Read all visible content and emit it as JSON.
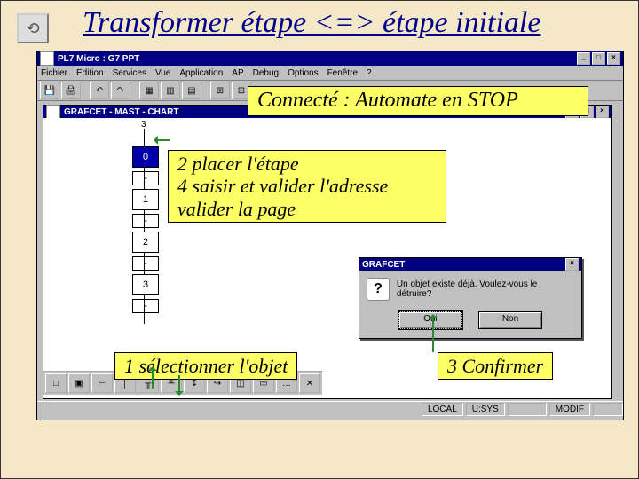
{
  "slide": {
    "title": "Transformer étape <=> étape initiale"
  },
  "app": {
    "title": "PL7 Micro : G7 PPT",
    "menus": [
      "Fichier",
      "Edition",
      "Services",
      "Vue",
      "Application",
      "AP",
      "Debug",
      "Options",
      "Fenêtre",
      "?"
    ],
    "mdi_title": "GRAFCET - MAST - CHART",
    "status": {
      "local": "LOCAL",
      "usys": "U:SYS",
      "modif": "MODIF"
    }
  },
  "grafcet": {
    "coord": "3",
    "nodes": [
      "0",
      "1",
      "2",
      "3"
    ],
    "dashes": [
      "-",
      "-",
      "-",
      "-"
    ]
  },
  "dialog": {
    "title": "GRAFCET",
    "msg": "Un objet existe déjà. Voulez-vous le détruire?",
    "yes": "Oui",
    "no": "Non"
  },
  "callouts": {
    "status": "Connecté : Automate en STOP",
    "step2a": "2 placer l'étape",
    "step2b": "4 saisir et valider l'adresse",
    "step2c": "valider la page",
    "step1": "1 sélectionner l'objet",
    "step3": "3 Confirmer"
  }
}
